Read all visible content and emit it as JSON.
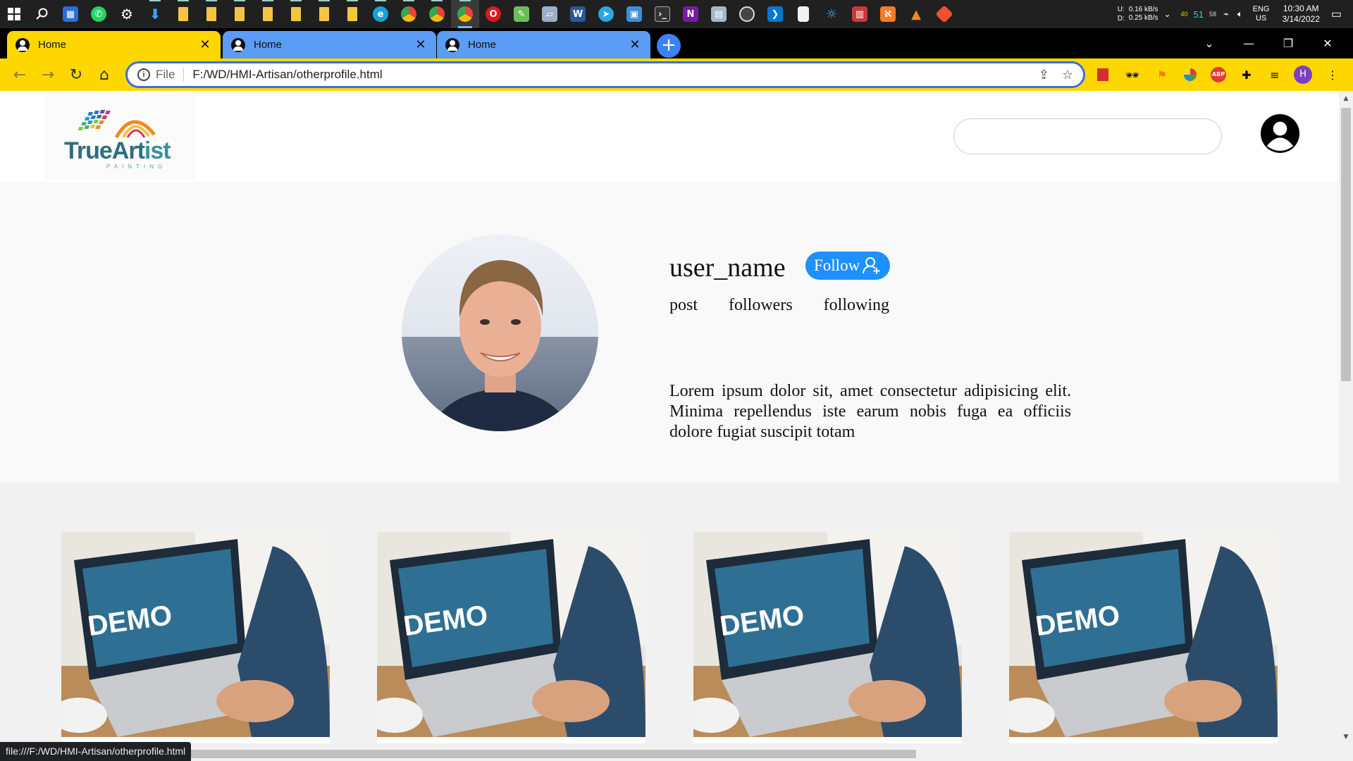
{
  "taskbar": {
    "icons": [
      "windows-start-icon",
      "search-icon",
      "store-icon",
      "whatsapp-icon",
      "settings-icon",
      "download-icon",
      "folder-icon",
      "folder-icon",
      "folder-icon",
      "folder-icon",
      "folder-icon",
      "folder-icon",
      "folder-icon",
      "edge-icon",
      "chrome-profile-icon",
      "chrome-profile-icon",
      "chrome-active-icon",
      "opera-icon",
      "notepad-icon",
      "sticky-icon",
      "word-icon",
      "telegram-icon",
      "remote-icon",
      "terminal-icon",
      "onenote-icon",
      "photos-icon",
      "obs-icon",
      "vscode-icon",
      "file-icon",
      "lightbulb-icon",
      "archive-icon",
      "xampp-icon",
      "vlc-icon",
      "git-icon"
    ],
    "net_up_label": "U:",
    "net_down_label": "D:",
    "net_up": "0.16 kB/s",
    "net_down": "0.25 kB/s",
    "temp1": "40",
    "temp2": "51",
    "temp3": "58",
    "lang": "ENG",
    "region": "US",
    "time": "10:30 AM",
    "date": "3/14/2022"
  },
  "browser": {
    "tabs": [
      {
        "title": "Home",
        "active": true
      },
      {
        "title": "Home",
        "active": false
      },
      {
        "title": "Home",
        "active": false
      }
    ],
    "new_tab": "+",
    "scheme": "File",
    "url": "F:/WD/HMI-Artisan/otherprofile.html",
    "status_url": "file:///F:/WD/HMI-Artisan/otherprofile.html",
    "profile_initial": "H",
    "colors": {
      "frame_accent": "#ffd700",
      "inactive_tab": "#5b9cf5",
      "omnibox_border": "#3b6fe0"
    }
  },
  "site": {
    "logo_main": "TrueArt",
    "logo_accent": "ist",
    "logo_sub": "PAINTING",
    "search_placeholder": ""
  },
  "profile": {
    "username": "user_name",
    "follow_label": "Follow",
    "stats": {
      "post": "post",
      "followers": "followers",
      "following": "following"
    },
    "bio": "Lorem ipsum dolor sit, amet consectetur adipisicing elit. Minima repellendus iste earum nobis fuga ea officiis dolore fugiat suscipit totam",
    "follow_color": "#1e90ff"
  },
  "posts": [
    {
      "caption": "DEMO"
    },
    {
      "caption": "DEMO"
    },
    {
      "caption": "DEMO"
    },
    {
      "caption": "DEMO"
    }
  ]
}
